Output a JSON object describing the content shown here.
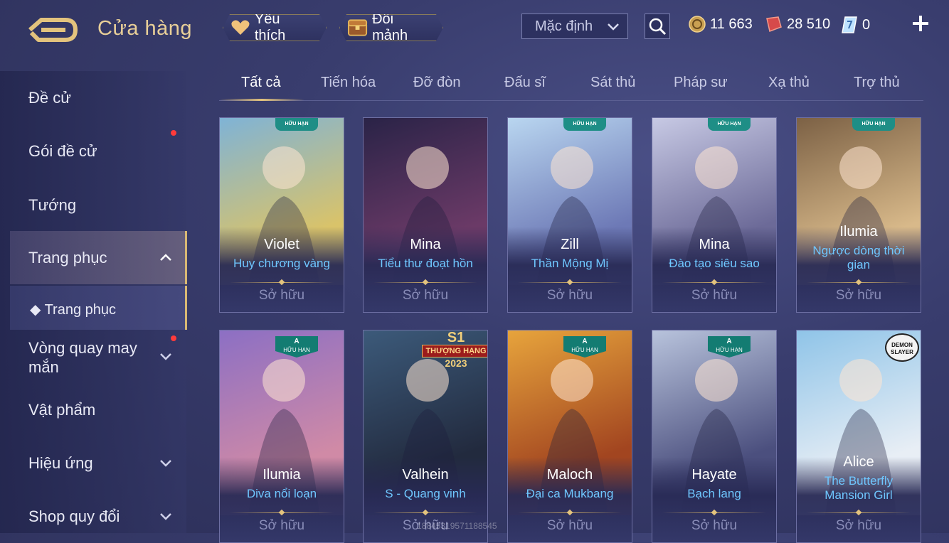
{
  "header": {
    "title": "Cửa hàng",
    "favorite_label": "Yêu thích",
    "exchange_label": "Đổi mảnh",
    "sort_value": "Mặc định",
    "currencies": [
      {
        "icon": "gold-coin-icon",
        "value": "11 663"
      },
      {
        "icon": "voucher-icon",
        "value": "28 510"
      },
      {
        "icon": "token-icon",
        "value": "0"
      }
    ]
  },
  "sidebar": {
    "items": [
      {
        "label": "Đề cử"
      },
      {
        "label": "Gói đề cử"
      },
      {
        "label": "Tướng"
      },
      {
        "label": "Trang phục"
      },
      {
        "label": "Trang phục"
      },
      {
        "label": "Vòng quay may mắn"
      },
      {
        "label": "Vật phẩm"
      },
      {
        "label": "Hiệu ứng"
      },
      {
        "label": "Shop quy đổi"
      }
    ]
  },
  "tabs": [
    {
      "label": "Tất cả"
    },
    {
      "label": "Tiến hóa"
    },
    {
      "label": "Đỡ đòn"
    },
    {
      "label": "Đấu sĩ"
    },
    {
      "label": "Sát thủ"
    },
    {
      "label": "Pháp sư"
    },
    {
      "label": "Xạ thủ"
    },
    {
      "label": "Trợ thủ"
    }
  ],
  "cards": [
    {
      "hero": "Violet",
      "skin": "Huy chương vàng",
      "status": "Sở hữu",
      "badge": "HỮU HẠN",
      "color1": "#7fb3d6",
      "color2": "#d9c36a"
    },
    {
      "hero": "Mina",
      "skin": "Tiểu thư đoạt hồn",
      "status": "Sở hữu",
      "badge": "",
      "color1": "#2a2347",
      "color2": "#6b3a67"
    },
    {
      "hero": "Zill",
      "skin": "Thần Mộng Mị",
      "status": "Sở hữu",
      "badge": "HỮU HẠN",
      "color1": "#b9d6f0",
      "color2": "#6d79b6"
    },
    {
      "hero": "Mina",
      "skin": "Đào tạo siêu sao",
      "status": "Sở hữu",
      "badge": "HỮU HẠN",
      "color1": "#c7c9e4",
      "color2": "#6c6a98"
    },
    {
      "hero": "Ilumia",
      "skin": "Ngược dòng thời gian",
      "status": "Sở hữu",
      "badge": "HỮU HẠN",
      "color1": "#7c6145",
      "color2": "#d8b98a"
    },
    {
      "hero": "Ilumia",
      "skin": "Diva nổi loạn",
      "status": "Sở hữu",
      "badge": "HỮU HẠN",
      "badge_grade": "A",
      "color1": "#8c6fc4",
      "color2": "#d08aa6"
    },
    {
      "hero": "Valhein",
      "skin": "S - Quang vinh",
      "status": "Sở hữu",
      "event_badge": [
        "S1",
        "THƯỢNG HẠNG",
        "2023"
      ],
      "color1": "#3c5a7a",
      "color2": "#222a3e"
    },
    {
      "hero": "Maloch",
      "skin": "Đại ca Mukbang",
      "status": "Sở hữu",
      "badge": "HỮU HẠN",
      "badge_grade": "A",
      "color1": "#e7a43c",
      "color2": "#a24520"
    },
    {
      "hero": "Hayate",
      "skin": "Bạch lang",
      "status": "Sở hữu",
      "badge": "HỮU HẠN",
      "badge_grade": "A",
      "color1": "#b8c3dc",
      "color2": "#4b4f7e"
    },
    {
      "hero": "Alice",
      "skin": "The Butterfly Mansion Girl",
      "status": "Sở hữu",
      "demon_badge": [
        "DEMON",
        "SLAYER"
      ],
      "color1": "#8fc4e8",
      "color2": "#e8eef5"
    }
  ],
  "watermark": "18845319571188545"
}
